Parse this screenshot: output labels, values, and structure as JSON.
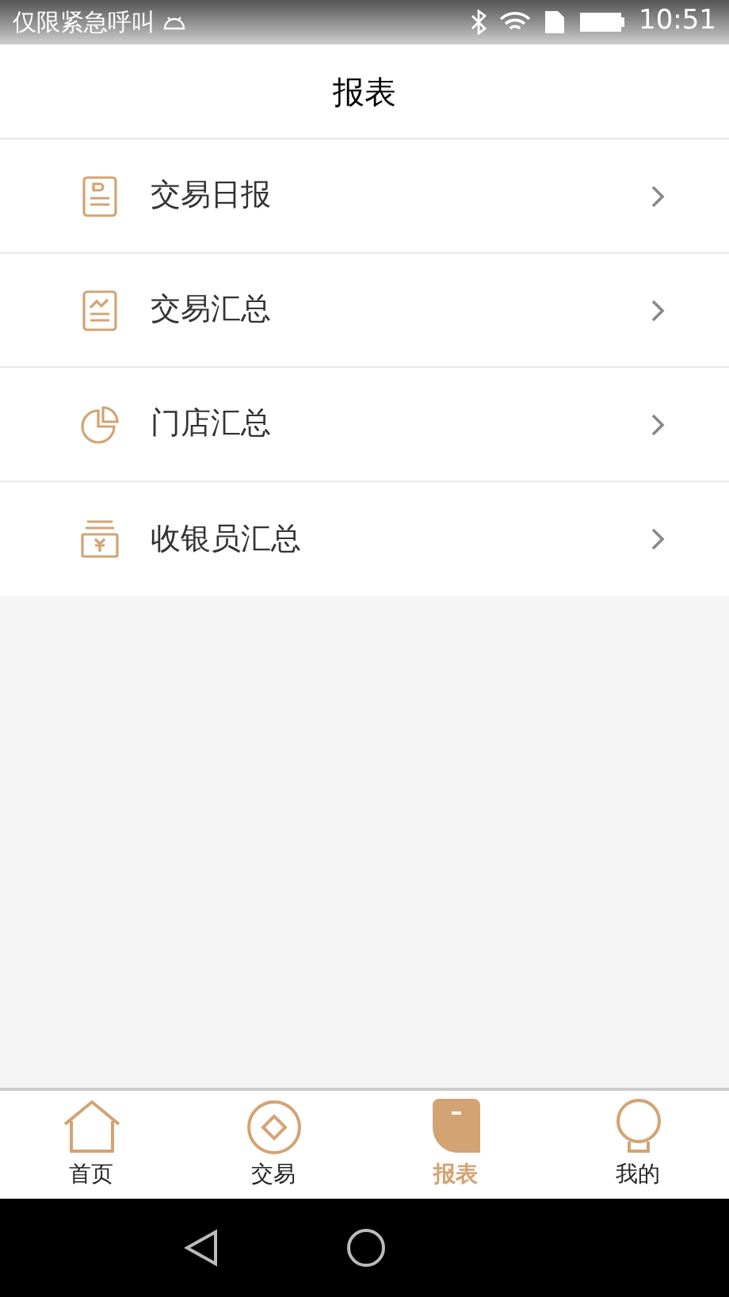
{
  "status_bar": {
    "carrier": "仅限紧急呼叫",
    "time": "10:51"
  },
  "header": {
    "title": "报表"
  },
  "menu": [
    {
      "kind": "daily",
      "label": "交易日报"
    },
    {
      "kind": "trend",
      "label": "交易汇总"
    },
    {
      "kind": "pie",
      "label": "门店汇总"
    },
    {
      "kind": "cashier",
      "label": "收银员汇总"
    }
  ],
  "tabs": [
    {
      "kind": "home",
      "label": "首页",
      "selected": false
    },
    {
      "kind": "trade",
      "label": "交易",
      "selected": false
    },
    {
      "kind": "report",
      "label": "报表",
      "selected": true
    },
    {
      "kind": "mine",
      "label": "我的",
      "selected": false
    }
  ]
}
